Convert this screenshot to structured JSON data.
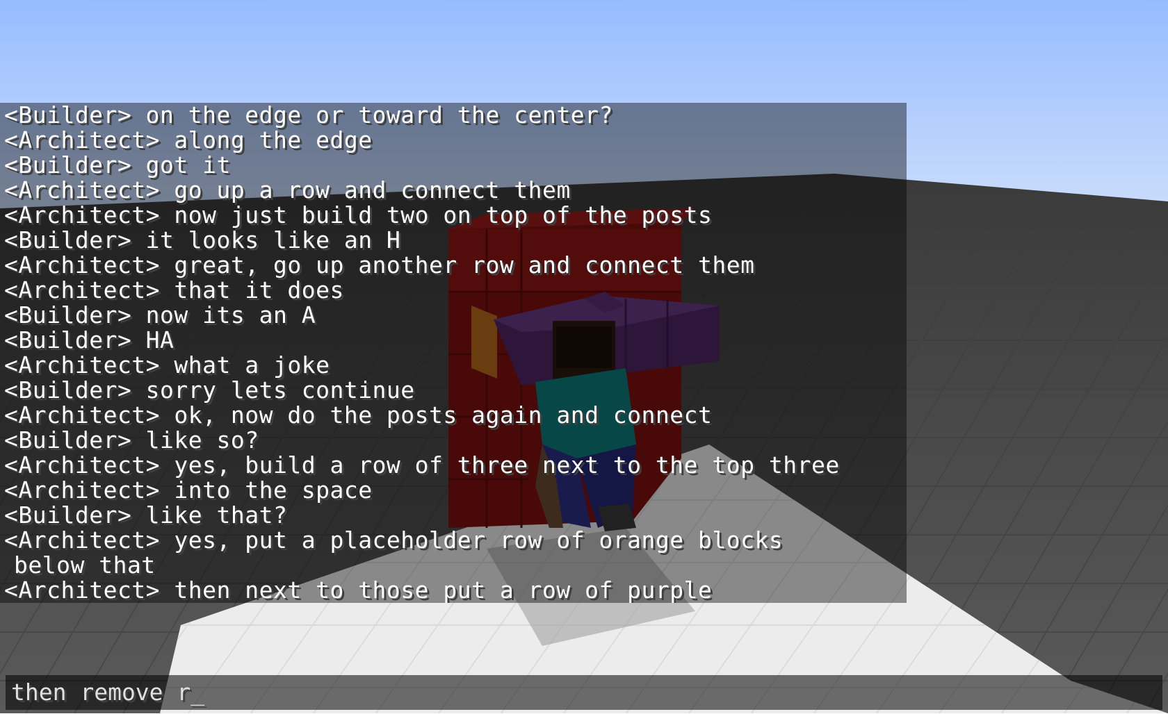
{
  "chat": {
    "messages": [
      "<Builder> on the edge or toward the center?",
      "<Architect> along the edge",
      "<Builder> got it",
      "<Architect> go up a row and connect them",
      "<Architect> now just build two on top of the posts",
      "<Builder> it looks like an H",
      "<Architect> great, go up another row and connect them",
      "<Architect> that it does",
      "<Builder> now its an A",
      "<Builder> HA",
      "<Architect> what a joke",
      "<Builder> sorry lets continue",
      "<Architect> ok, now do the posts again and connect",
      "<Builder> like so?",
      "<Architect> yes, build a row of three next to the top three",
      "<Architect> into the space",
      "<Builder> like that?",
      "<Architect> yes, put a placeholder row of orange blocks",
      "below that",
      "<Architect> then next to those put a row of purple"
    ],
    "input_value": "then remove r",
    "cursor": "_"
  },
  "colors": {
    "sky_top": "#97bcff",
    "sky_bottom": "#c9dcfd",
    "ground": "#4a4a4a",
    "platform": "#e9e9e9",
    "red_block": "#8b1313",
    "purple_block": "#5b2f72",
    "orange_block": "#b0641a"
  }
}
